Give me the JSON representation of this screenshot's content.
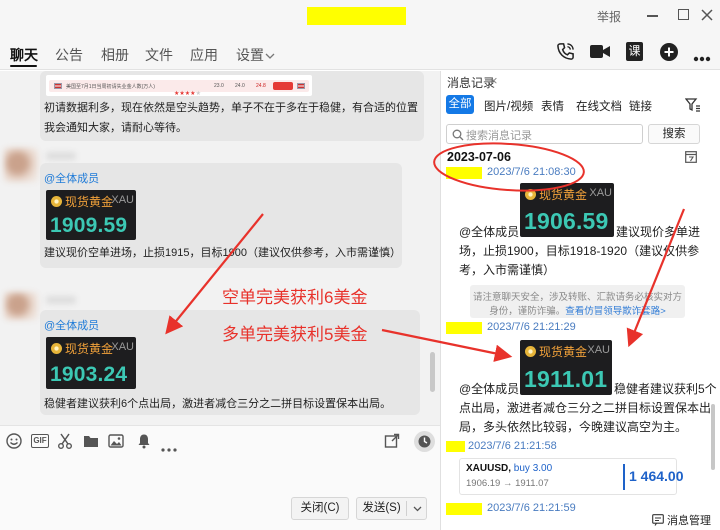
{
  "titlebar": {
    "report_label": "举报"
  },
  "tabs": {
    "chat": "聊天",
    "notice": "公告",
    "album": "相册",
    "files": "文件",
    "apps": "应用",
    "settings": "设置"
  },
  "header_actions": {
    "course_label": "课"
  },
  "chat": {
    "msg1": {
      "calendar": {
        "title": "美国至7月1日当周初请失业金人数(万人)",
        "rating": 4,
        "rating_max": 5,
        "values": [
          "23.0",
          "24.0",
          "24.8"
        ]
      },
      "lines": [
        "初请数据利多，现在依然是空头趋势，单子不在于多在于稳健，有合适的位置",
        "我会通知大家，请耐心等待。"
      ]
    },
    "msg2": {
      "mention": "@全体成员",
      "ticker": {
        "name": "现货黄金",
        "code": "XAU",
        "price": "1909.59"
      },
      "text": "建议现价空单进场，止损1915，目标1900（建议仅供参考，入市需谨慎）"
    },
    "msg3": {
      "mention": "@全体成员",
      "ticker": {
        "name": "现货黄金",
        "code": "XAU",
        "price": "1903.24"
      },
      "text": "稳健者建议获利6个点出局，激进者减仓三分之二拼目标设置保本出局。"
    }
  },
  "annotations": {
    "short_trade": "空单完美获利6美金",
    "long_trade": "多单完美获利5美金"
  },
  "composer": {
    "gif_label": "GIF",
    "close_button": "关闭(C)",
    "send_button": "发送(S)"
  },
  "history": {
    "title": "消息记录",
    "close": "×",
    "filters": [
      "全部",
      "图片/视频",
      "表情",
      "在线文档",
      "链接"
    ],
    "search": {
      "placeholder": "搜索消息记录",
      "button": "搜索"
    },
    "date": "2023-07-06",
    "records": [
      {
        "time": "2023/7/6 21:08:30",
        "mention": "@全体成员",
        "ticker": {
          "name": "现货黄金",
          "code": "XAU",
          "price": "1906.59"
        },
        "lines": [
          "建议现价多单进",
          "场，止损1900，目标1918-1920（建议仅供参",
          "考，入市需谨慎）"
        ]
      },
      {
        "time": "2023/7/6 21:21:29",
        "mention": "@全体成员",
        "ticker": {
          "name": "现货黄金",
          "code": "XAU",
          "price": "1911.01"
        },
        "lines": [
          "稳健者建议获利5个",
          "点出局，激进者减仓三分之二拼目标设置保本出",
          "局，多头依然比较弱，今晚建议高空为主。"
        ]
      },
      {
        "time": "2023/7/6 21:21:58",
        "trade": {
          "symbol": "XAUUSD,",
          "side": "buy 3.00",
          "prices": "1906.19 → 1911.07",
          "profit": "1 464.00"
        }
      },
      {
        "time": "2023/7/6 21:21:59"
      }
    ],
    "safety_notice": {
      "line1": "请注意聊天安全，涉及转账、汇款请务必核实对方",
      "line2": "身份，谨防诈骗。",
      "link": "查看仿冒领导欺诈套路>"
    },
    "manage_label": "消息管理"
  },
  "colors": {
    "accent": "#1479e6",
    "annotation_red": "#e8322b",
    "ticker_price": "#3cc8b4",
    "ticker_name": "#f2a23a",
    "mention": "#1f7bd8",
    "highlight_yellow": "#ffff00"
  }
}
